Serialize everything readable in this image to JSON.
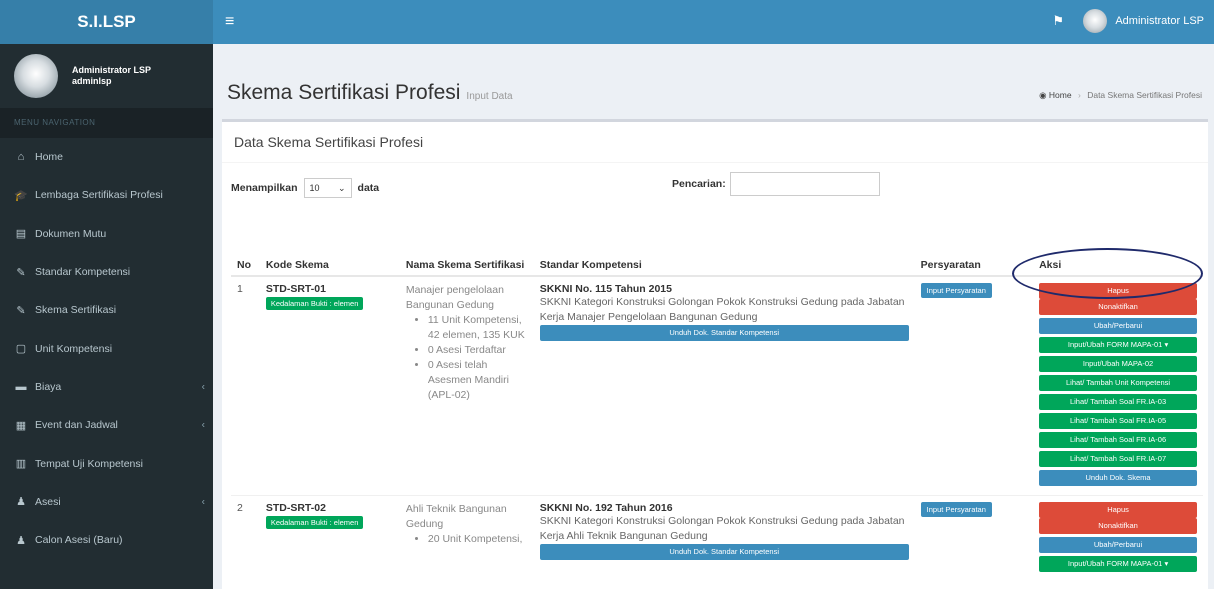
{
  "app": {
    "logo": "S.I.LSP"
  },
  "sidebar": {
    "user_name": "Administrator LSP",
    "user_login": "adminlsp",
    "menu_header": "MENU NAVIGATION",
    "items": [
      {
        "label": "Home",
        "icon": "home-icon",
        "glyph": "⌂",
        "caret": false
      },
      {
        "label": "Lembaga Sertifikasi Profesi",
        "icon": "graduation-cap-icon",
        "glyph": "🎓",
        "caret": false
      },
      {
        "label": "Dokumen Mutu",
        "icon": "file-icon",
        "glyph": "▤",
        "caret": false
      },
      {
        "label": "Standar Kompetensi",
        "icon": "tools-icon",
        "glyph": "✎",
        "caret": false
      },
      {
        "label": "Skema Sertifikasi",
        "icon": "edit-icon",
        "glyph": "✎",
        "caret": false
      },
      {
        "label": "Unit Kompetensi",
        "icon": "document-icon",
        "glyph": "▢",
        "caret": false
      },
      {
        "label": "Biaya",
        "icon": "money-icon",
        "glyph": "▬",
        "caret": true
      },
      {
        "label": "Event dan Jadwal",
        "icon": "calendar-icon",
        "glyph": "▦",
        "caret": true
      },
      {
        "label": "Tempat Uji Kompetensi",
        "icon": "building-icon",
        "glyph": "▥",
        "caret": false
      },
      {
        "label": "Asesi",
        "icon": "users-icon",
        "glyph": "♟",
        "caret": true
      },
      {
        "label": "Calon Asesi (Baru)",
        "icon": "users-icon",
        "glyph": "♟",
        "caret": false
      }
    ]
  },
  "topbar": {
    "user": "Administrator LSP"
  },
  "header": {
    "title": "Skema Sertifikasi Profesi",
    "subtitle": "Input Data",
    "breadcrumb_home": "Home",
    "breadcrumb_current": "Data Skema Sertifikasi Profesi"
  },
  "box": {
    "title": "Data Skema Sertifikasi Profesi",
    "show_label": "Menampilkan",
    "show_value": "10",
    "show_suffix": "data",
    "search_label": "Pencarian:",
    "search_value": ""
  },
  "table": {
    "headers": {
      "no": "No",
      "kode": "Kode Skema",
      "nama": "Nama Skema Sertifikasi",
      "standar": "Standar Kompetensi",
      "persyaratan": "Persyaratan",
      "aksi": "Aksi"
    },
    "rows": [
      {
        "no": "1",
        "kode": "STD-SRT-01",
        "badge": "Kedalaman Bukti : elemen",
        "nama": "Manajer pengelolaan Bangunan Gedung",
        "bullets": [
          "11 Unit Kompetensi, 42 elemen, 135 KUK",
          "0 Asesi Terdaftar",
          "0 Asesi telah Asesmen Mandiri (APL-02)"
        ],
        "standar_title": "SKKNI No. 115 Tahun 2015",
        "standar_desc": "SKKNI Kategori Konstruksi Golongan Pokok Konstruksi Gedung pada Jabatan Kerja Manajer Pengelolaan Bangunan Gedung",
        "unduh_standar": "Unduh Dok. Standar Kompetensi",
        "persyaratan_btn": "Input Persyaratan",
        "aksi": {
          "hapus": "Hapus",
          "nonaktif": "Nonaktifkan",
          "ubah": "Ubah/Perbarui",
          "mapa01": "Input/Ubah FORM MAPA-01",
          "mapa02": "Input/Ubah MAPA-02",
          "unit": "Lihat/ Tambah Unit Kompetensi",
          "ia03": "Lihat/ Tambah Soal FR.IA-03",
          "ia05": "Lihat/ Tambah Soal FR.IA-05",
          "ia06": "Lihat/ Tambah Soal FR.IA-06",
          "ia07": "Lihat/ Tambah Soal FR.IA-07",
          "unduh_skema": "Unduh Dok. Skema"
        }
      },
      {
        "no": "2",
        "kode": "STD-SRT-02",
        "badge": "Kedalaman Bukti : elemen",
        "nama": "Ahli Teknik Bangunan Gedung",
        "bullets": [
          "20 Unit Kompetensi,"
        ],
        "standar_title": "SKKNI No. 192 Tahun 2016",
        "standar_desc": "SKKNI Kategori Konstruksi Golongan Pokok Konstruksi Gedung pada Jabatan Kerja Ahli Teknik Bangunan Gedung",
        "unduh_standar": "Unduh Dok. Standar Kompetensi",
        "persyaratan_btn": "Input Persyaratan",
        "aksi": {
          "hapus": "Hapus",
          "nonaktif": "Nonaktifkan",
          "ubah": "Ubah/Perbarui",
          "mapa01": "Input/Ubah FORM MAPA-01"
        }
      }
    ]
  },
  "colors": {
    "header_blue": "#3c8dbc",
    "logo_blue": "#367fa9",
    "sidebar": "#222d32",
    "danger": "#dd4b39",
    "success": "#00a65a",
    "highlight": "#1f2a6b"
  }
}
